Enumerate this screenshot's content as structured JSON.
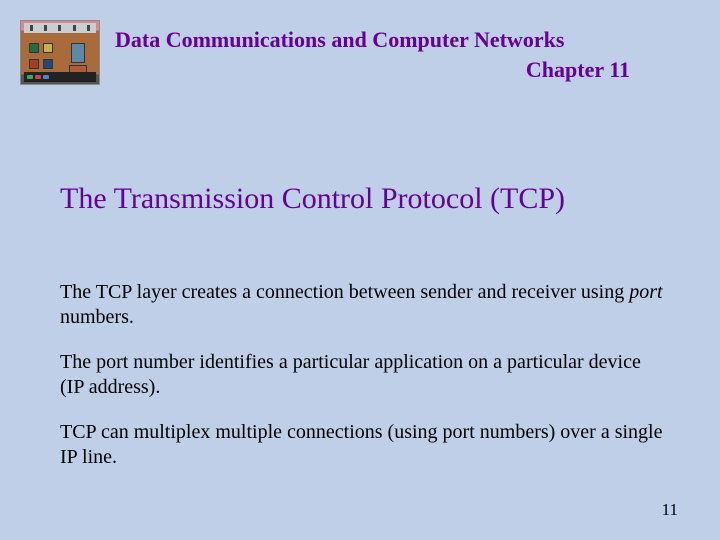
{
  "header": {
    "title_line1": "Data Communications and Computer Networks",
    "title_line2": "Chapter 11"
  },
  "heading": "The Transmission Control Protocol (TCP)",
  "paragraphs": {
    "p1_pre": "The TCP layer creates a connection between sender and receiver using ",
    "p1_em": "port",
    "p1_post": " numbers.",
    "p2": "The port number identifies a particular application on a particular device (IP address).",
    "p3": "TCP can multiplex multiple connections (using port numbers) over a single IP line."
  },
  "page_number": "11"
}
